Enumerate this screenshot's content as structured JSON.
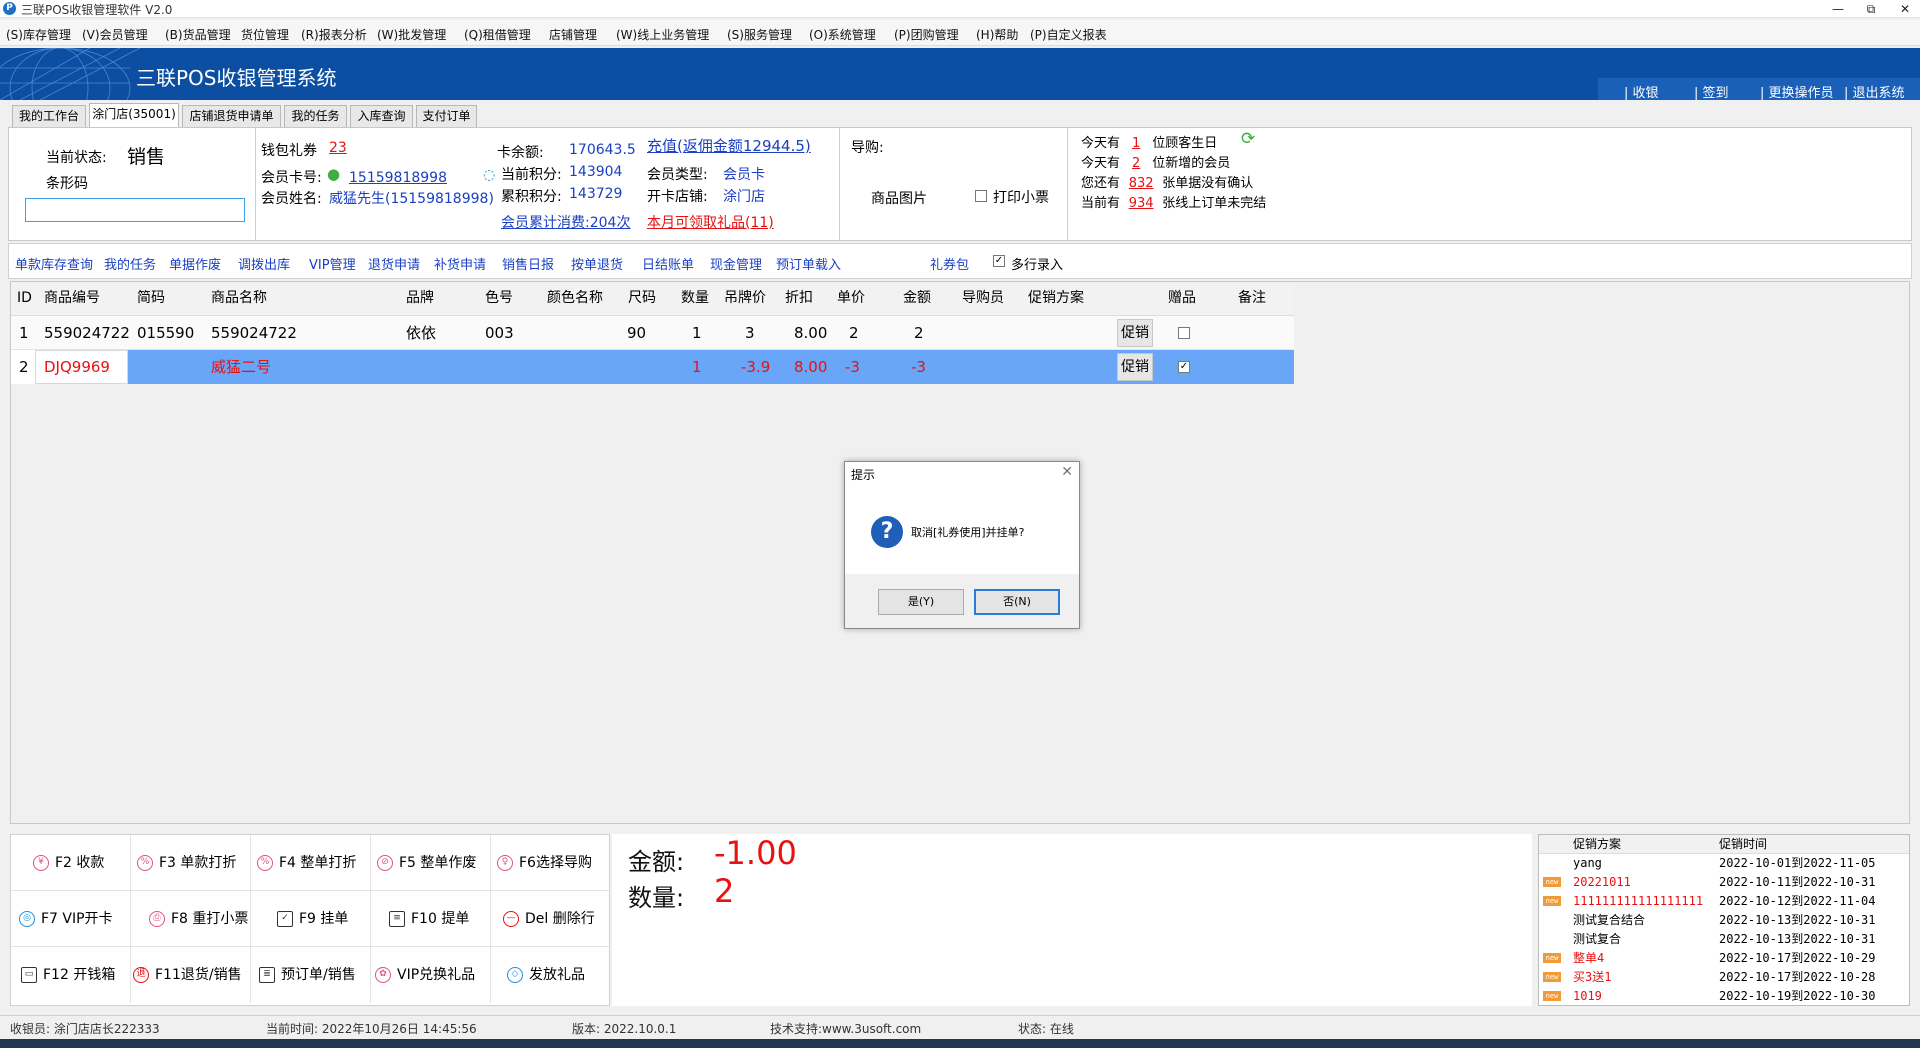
{
  "window": {
    "title": "三联POS收银管理软件 V2.0",
    "app_icon_glyph": "P",
    "minimize_glyph": "—",
    "restore_glyph": "⧉",
    "close_glyph": "✕"
  },
  "menu": [
    "(S)库存管理",
    "(V)会员管理",
    "(B)货品管理",
    "货位管理",
    "(R)报表分析",
    "(W)批发管理",
    "(Q)租借管理",
    "店铺管理",
    "(W)线上业务管理",
    "(S)服务管理",
    "(O)系统管理",
    "(P)团购管理",
    "(H)帮助",
    "(P)自定义报表"
  ],
  "banner": {
    "system_title": "三联POS收银管理系统",
    "nav": [
      "收银",
      "签到",
      "更换操作员",
      "退出系统"
    ]
  },
  "tabs": [
    "我的工作台",
    "涂门店(35001)",
    "店铺退货申请单",
    "我的任务",
    "入库查询",
    "支付订单"
  ],
  "status_panel": {
    "state_label": "当前状态:",
    "state_value": "销售",
    "barcode_label": "条形码",
    "barcode_value": ""
  },
  "member": {
    "wallet_label": "钱包礼券",
    "wallet_value": "23",
    "card_no_label": "会员卡号:",
    "card_no_value": "15159818998",
    "name_label": "会员姓名:",
    "name_value": "威猛先生(15159818998)",
    "balance_label": "卡余额:",
    "balance_value": "170643.5",
    "points_label": "当前积分:",
    "points_value": "143904",
    "accum_points_label": "累积积分:",
    "accum_points_value": "143729",
    "recharge_link": "充值(返佣金额12944.5)",
    "member_type_label": "会员类型:",
    "member_type_value": "会员卡",
    "open_store_label": "开卡店铺:",
    "open_store_value": "涂门店",
    "consume_link": "会员累计消费:204次",
    "gift_link": "本月可领取礼品(11)"
  },
  "guide": {
    "label": "导购:",
    "image_label": "商品图片",
    "print_label": "打印小票",
    "print_checked": false
  },
  "notices": [
    {
      "prefix": "今天有",
      "count": "1",
      "suffix": "位顾客生日"
    },
    {
      "prefix": "今天有",
      "count": "2",
      "suffix": "位新增的会员"
    },
    {
      "prefix": "您还有",
      "count": "832",
      "suffix": "张单据没有确认"
    },
    {
      "prefix": "当前有",
      "count": "934",
      "suffix": "张线上订单未完结"
    }
  ],
  "refresh_icon_glyph": "⟳",
  "links": [
    "单款库存查询",
    "我的任务",
    "单据作废",
    "调拨出库",
    "VIP管理",
    "退货申请",
    "补货申请",
    "销售日报",
    "按单退货",
    "日结账单",
    "现金管理",
    "预订单载入",
    "礼券包"
  ],
  "multi_row": {
    "label": "多行录入",
    "checked": true
  },
  "grid": {
    "columns": [
      "ID",
      "商品编号",
      "简码",
      "商品名称",
      "品牌",
      "色号",
      "颜色名称",
      "尺码",
      "数量",
      "吊牌价",
      "折扣",
      "单价",
      "金额",
      "导购员",
      "促销方案",
      "",
      "赠品",
      "备注"
    ],
    "promo_button_label": "促销",
    "rows": [
      {
        "id": "1",
        "code": "559024722",
        "short": "015590",
        "name": "559024722",
        "brand": "依依",
        "color_no": "003",
        "color_name": "",
        "size": "90",
        "qty": "1",
        "tag_price": "3",
        "discount": "8.00",
        "unit_price": "2",
        "amount": "2",
        "guide": "",
        "promo": "",
        "gift": false,
        "remark": ""
      },
      {
        "id": "2",
        "code": "DJQ9969",
        "short": "",
        "name": "威猛二号",
        "brand": "",
        "color_no": "",
        "color_name": "",
        "size": "",
        "qty": "1",
        "tag_price": "-3.9",
        "discount": "8.00",
        "unit_price": "-3",
        "amount": "-3",
        "guide": "",
        "promo": "",
        "gift": true,
        "remark": ""
      }
    ]
  },
  "dialog": {
    "title": "提示",
    "close_glyph": "✕",
    "icon_glyph": "?",
    "message": "取消[礼券使用]并挂单?",
    "yes": "是(Y)",
    "no": "否(N)"
  },
  "fkeys": [
    {
      "label": "F2 收款",
      "icon": "yen-icon",
      "glyph": "¥"
    },
    {
      "label": "F3 单款打折",
      "icon": "percent-icon",
      "glyph": "%"
    },
    {
      "label": "F4 整单打折",
      "icon": "percent-icon",
      "glyph": "%"
    },
    {
      "label": "F5 整单作废",
      "icon": "void-icon",
      "glyph": "⊘"
    },
    {
      "label": "F6选择导购",
      "icon": "guide-icon",
      "glyph": "♀"
    },
    {
      "label": "F7 VIP开卡",
      "icon": "vip-card-icon",
      "glyph": "◎"
    },
    {
      "label": "F8 重打小票",
      "icon": "reprint-icon",
      "glyph": "⎙"
    },
    {
      "label": "F9 挂单",
      "icon": "hang-order-icon",
      "glyph": "✓"
    },
    {
      "label": "F10 提单",
      "icon": "retrieve-order-icon",
      "glyph": "≡"
    },
    {
      "label": "Del 删除行",
      "icon": "delete-icon",
      "glyph": "—"
    },
    {
      "label": "F12 开钱箱",
      "icon": "cash-drawer-icon",
      "glyph": "▭"
    },
    {
      "label": "F11退货/销售",
      "icon": "return-icon",
      "glyph": "退"
    },
    {
      "label": "预订单/销售",
      "icon": "preorder-icon",
      "glyph": "≣"
    },
    {
      "label": "VIP兑换礼品",
      "icon": "gift-icon",
      "glyph": "✿"
    },
    {
      "label": "发放礼品",
      "icon": "tag-icon",
      "glyph": "◇"
    }
  ],
  "totals": {
    "amount_label": "金额:",
    "amount_value": "-1.00",
    "qty_label": "数量:",
    "qty_value": "2"
  },
  "promotions": {
    "headers": [
      "促销方案",
      "促销时间"
    ],
    "new_tag": "new",
    "rows": [
      {
        "name": "yang",
        "time": "2022-10-01到2022-11-05",
        "is_new": false,
        "red": false
      },
      {
        "name": "20221011",
        "time": "2022-10-11到2022-10-31",
        "is_new": true,
        "red": true
      },
      {
        "name": "111111111111111111",
        "time": "2022-10-12到2022-11-04",
        "is_new": true,
        "red": true
      },
      {
        "name": "测试复合结合",
        "time": "2022-10-13到2022-10-31",
        "is_new": false,
        "red": false
      },
      {
        "name": "测试复合",
        "time": "2022-10-13到2022-10-31",
        "is_new": false,
        "red": false
      },
      {
        "name": "整单4",
        "time": "2022-10-17到2022-10-29",
        "is_new": true,
        "red": true
      },
      {
        "name": "买3送1",
        "time": "2022-10-17到2022-10-28",
        "is_new": true,
        "red": true
      },
      {
        "name": "1019",
        "time": "2022-10-19到2022-10-30",
        "is_new": true,
        "red": true
      }
    ]
  },
  "statusbar": {
    "cashier": "收银员: 涂门店店长222333",
    "time": "当前时间: 2022年10月26日 14:45:56",
    "version": "版本: 2022.10.0.1",
    "support": "技术支持:www.3usoft.com",
    "state": "状态: 在线"
  },
  "colors": {
    "brand": "#0b4ea2",
    "accent_red": "#e81010",
    "link_blue": "#1a3fc2",
    "selected_row": "#6aa6f8"
  }
}
